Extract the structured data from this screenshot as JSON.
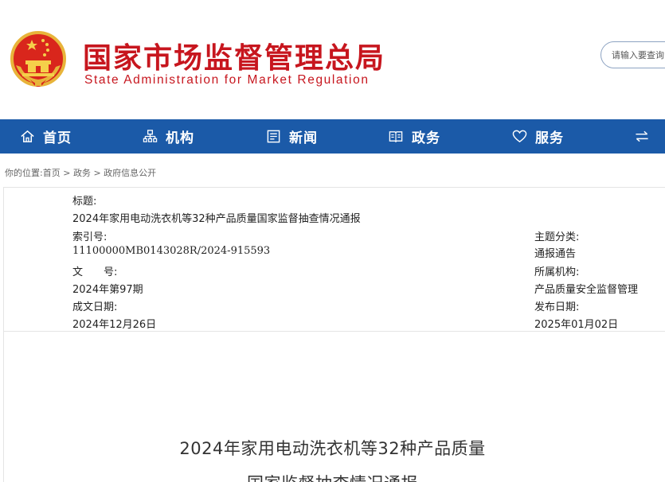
{
  "header": {
    "org_name_cn": "国家市场监督管理总局",
    "org_name_en": "State Administration for Market Regulation",
    "search_placeholder": "请输入要查询",
    "brand_color": "#c7161e"
  },
  "nav": {
    "color": "#1b5aa8",
    "items": [
      {
        "label": "首页",
        "icon": "home-icon"
      },
      {
        "label": "机构",
        "icon": "org-chart-icon"
      },
      {
        "label": "新闻",
        "icon": "news-icon"
      },
      {
        "label": "政务",
        "icon": "document-icon"
      },
      {
        "label": "服务",
        "icon": "heart-icon"
      },
      {
        "label": "",
        "icon": "exchange-arrows-icon"
      }
    ]
  },
  "breadcrumb": {
    "prefix": "你的位置:",
    "items": [
      "首页",
      "政务",
      "政府信息公开"
    ],
    "separator": ">"
  },
  "info": {
    "title_label": "标题:",
    "title_value": "2024年家用电动洗衣机等32种产品质量国家监督抽查情况通报",
    "index_label": "索引号:",
    "index_value": "11100000MB0143028R/2024-915593",
    "docno_label": "文　　号:",
    "docno_value": "2024年第97期",
    "created_label": "成文日期:",
    "created_value": "2024年12月26日",
    "category_label": "主题分类:",
    "category_value": "通报通告",
    "agency_label": "所属机构:",
    "agency_value": "产品质量安全监督管理",
    "published_label": "发布日期:",
    "published_value": "2025年01月02日"
  },
  "article": {
    "title_line1": "2024年家用电动洗衣机等32种产品质量",
    "title_line2": "国家监督抽查情况通报"
  }
}
